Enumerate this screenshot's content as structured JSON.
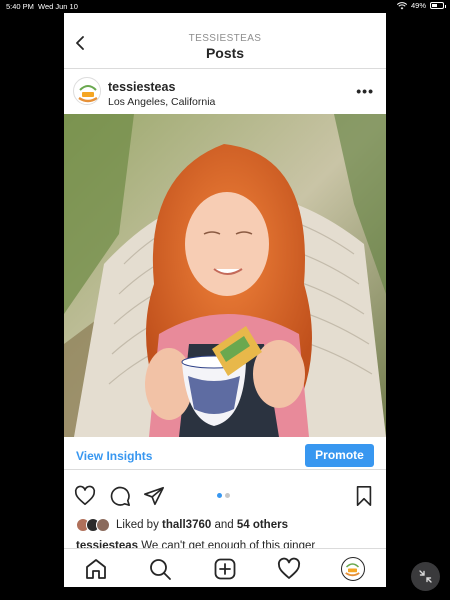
{
  "status_bar": {
    "time": "5:40 PM",
    "date": "Wed Jun 10",
    "battery": "49%",
    "battery_level": 0.49,
    "icons": [
      "wifi-icon",
      "battery-icon"
    ]
  },
  "nav": {
    "account": "TESSIESTEAS",
    "title": "Posts",
    "back_icon": "chevron-left-icon"
  },
  "post": {
    "username": "tessiesteas",
    "location": "Los Angeles, California",
    "more_icon": "more-horizontal-icon",
    "photo_alt": "post-photo",
    "insights_label": "View Insights",
    "promote_label": "Promote",
    "action_icons": [
      "heart-icon",
      "comment-icon",
      "share-icon",
      "bookmark-icon"
    ],
    "carousel": {
      "count": 2,
      "active": 1
    },
    "likes": {
      "prefix": "Liked by ",
      "user": "thall3760",
      "middle": " and ",
      "others": "54 others"
    },
    "caption": {
      "username": "tessiesteas",
      "text": " We can't get enough of this ginger"
    }
  },
  "tab_bar": [
    "home-icon",
    "search-icon",
    "new-post-icon",
    "activity-icon",
    "profile-icon"
  ],
  "colors": {
    "accent": "#3897f0",
    "text": "#262626",
    "muted": "#8e8e8e",
    "divider": "#dbdbdb"
  }
}
